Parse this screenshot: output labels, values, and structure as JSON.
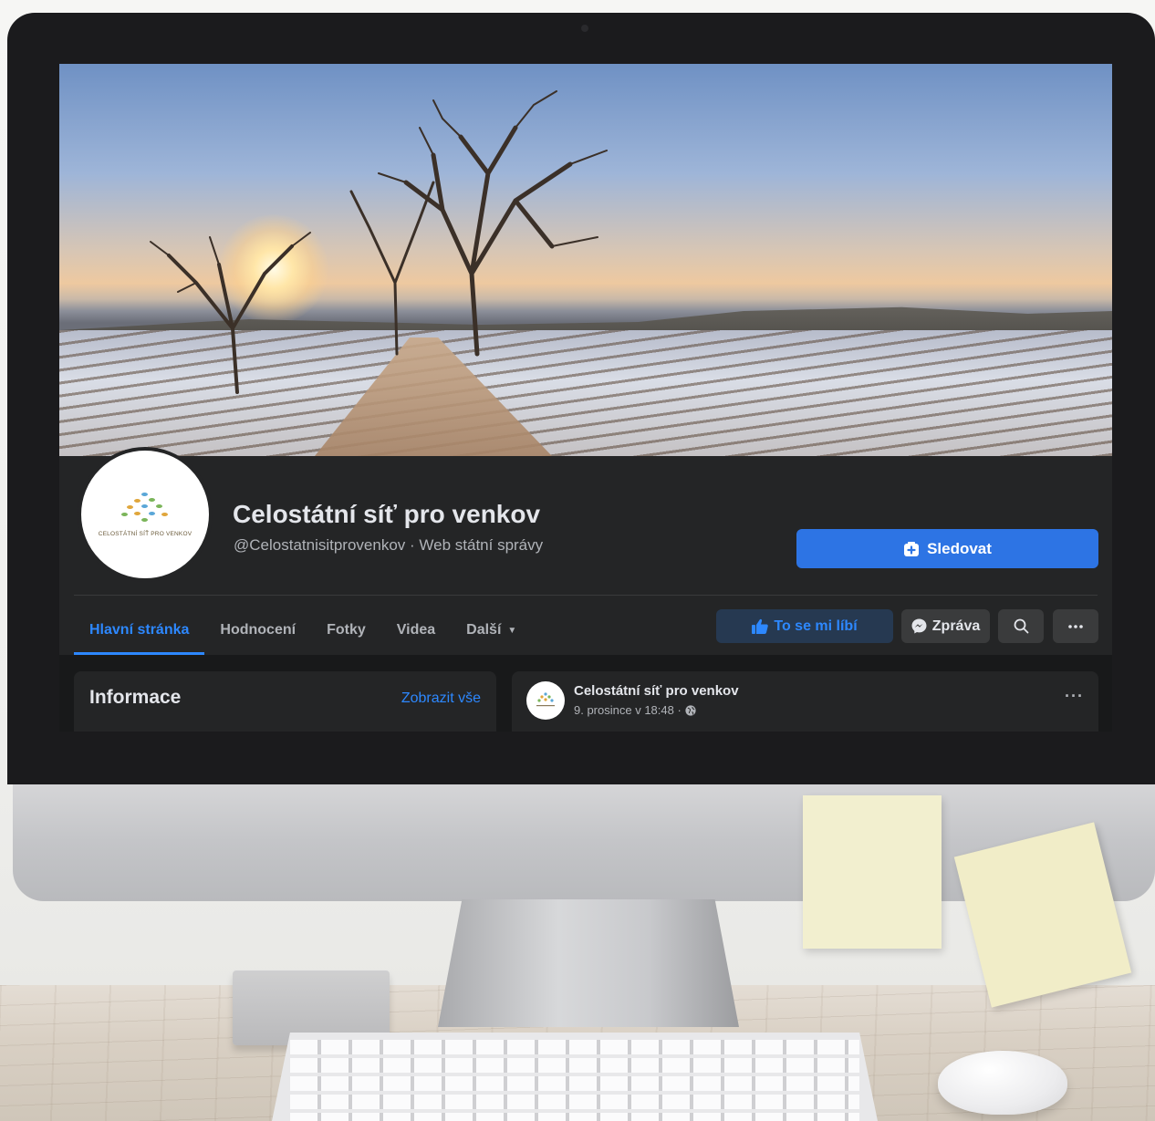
{
  "page": {
    "name": "Celostátní síť pro venkov",
    "handle_category": "@Celostatnisitprovenkov · Web státní správy",
    "avatar_logo_text": "CELOSTÁTNÍ SÍŤ PRO VENKOV"
  },
  "buttons": {
    "follow": "Sledovat",
    "like": "To se mi líbí",
    "message": "Zpráva"
  },
  "tabs": [
    {
      "label": "Hlavní stránka",
      "active": true
    },
    {
      "label": "Hodnocení",
      "active": false
    },
    {
      "label": "Fotky",
      "active": false
    },
    {
      "label": "Videa",
      "active": false
    },
    {
      "label": "Další",
      "active": false
    }
  ],
  "info_card": {
    "title": "Informace",
    "link": "Zobrazit vše"
  },
  "post": {
    "author": "Celostátní síť pro venkov",
    "meta": "9. prosince v 18:48 ·"
  },
  "icons": {
    "follow": "plus-square-icon",
    "like": "thumbs-up-icon",
    "message": "messenger-icon",
    "search": "search-icon",
    "more": "more-horizontal-icon",
    "privacy": "globe-icon",
    "dropdown": "caret-down-icon"
  },
  "colors": {
    "accent": "#2d88ff",
    "follow_button": "#2d74e4",
    "surface": "#242526",
    "background": "#18191a",
    "text_primary": "#e4e6eb",
    "text_secondary": "#b0b3b8"
  }
}
